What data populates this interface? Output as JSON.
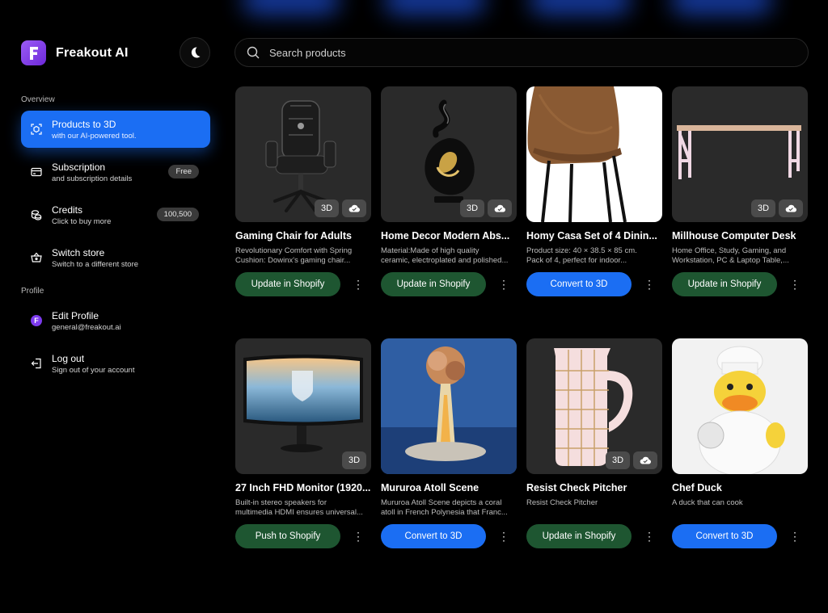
{
  "app": {
    "name": "Freakout AI",
    "logo_letter": "F"
  },
  "sidebar": {
    "overview_label": "Overview",
    "profile_label": "Profile",
    "items": [
      {
        "title": "Products to 3D",
        "subtitle": "with our AI-powered tool.",
        "icon": "cube-scan-icon",
        "active": true
      },
      {
        "title": "Subscription",
        "subtitle": "and subscription details",
        "icon": "credit-card-icon",
        "badge": "Free"
      },
      {
        "title": "Credits",
        "subtitle": "Click to buy more",
        "icon": "coins-icon",
        "badge": "100,500"
      },
      {
        "title": "Switch store",
        "subtitle": "Switch to a different store",
        "icon": "basket-icon"
      }
    ],
    "profile": {
      "title": "Edit Profile",
      "subtitle": "general@freakout.ai",
      "avatar_letter": "F"
    },
    "logout": {
      "title": "Log out",
      "subtitle": "Sign out of your account",
      "icon": "logout-icon"
    }
  },
  "search": {
    "placeholder": "Search products"
  },
  "badge_3d": "3D",
  "products": [
    {
      "title": "Gaming Chair for Adults",
      "desc1": "Revolutionary Comfort with Spring",
      "desc2": "Cushion: Dowinx's gaming chair...",
      "button": "Update in Shopify",
      "button_style": "green",
      "badges": [
        "3D",
        "cloud-check"
      ]
    },
    {
      "title": "Home Decor Modern Abs...",
      "desc1": "Material:Made of high quality",
      "desc2": "ceramic, electroplated and polished...",
      "button": "Update in Shopify",
      "button_style": "green",
      "badges": [
        "3D",
        "cloud-check"
      ]
    },
    {
      "title": "Homy Casa Set of 4 Dinin...",
      "desc1": "Product size: 40 × 38.5 × 85 cm.",
      "desc2": "Pack of 4, perfect for indoor...",
      "button": "Convert to 3D",
      "button_style": "blue",
      "badges": []
    },
    {
      "title": "Millhouse Computer Desk",
      "desc1": "Home Office, Study, Gaming, and",
      "desc2": "Workstation, PC & Laptop Table,...",
      "button": "Update in Shopify",
      "button_style": "green",
      "badges": [
        "3D",
        "cloud-check"
      ]
    },
    {
      "title": "27 Inch FHD Monitor (1920...",
      "desc1": "Built-in stereo speakers for",
      "desc2": "multimedia HDMI ensures universal...",
      "button": "Push to Shopify",
      "button_style": "green",
      "badges": [
        "3D"
      ]
    },
    {
      "title": "Mururoa Atoll Scene",
      "desc1": "Mururoa Atoll Scene depicts a coral",
      "desc2": "atoll in French Polynesia that Franc...",
      "button": "Convert to 3D",
      "button_style": "blue",
      "badges": []
    },
    {
      "title": "Resist Check Pitcher",
      "desc1": "Resist Check Pitcher",
      "desc2": "",
      "button": "Update in Shopify",
      "button_style": "green",
      "badges": [
        "3D",
        "cloud-check"
      ]
    },
    {
      "title": "Chef Duck",
      "desc1": "A duck that can cook",
      "desc2": "",
      "button": "Convert to 3D",
      "button_style": "blue",
      "badges": []
    }
  ],
  "more_glyph": "⋮"
}
